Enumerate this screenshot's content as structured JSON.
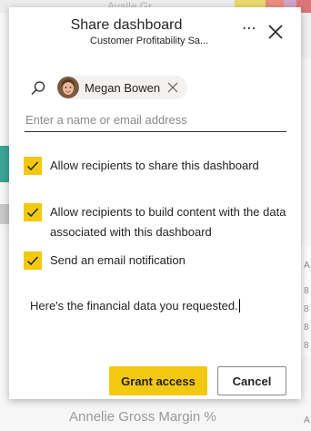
{
  "background": {
    "top_text": "Avalle Gr",
    "bottom_text": "Annelie Gross Margin %",
    "right_chars": [
      "A",
      "8",
      "8",
      "8",
      "8",
      "A"
    ],
    "bar_colors": [
      "#e8d86d",
      "#e88d80",
      "#d1a3c7",
      "#dc7575"
    ]
  },
  "dialog": {
    "title": "Share dashboard",
    "subtitle": "Customer Profitability Sa...",
    "more_label": "⋯",
    "recipient": {
      "name": "Megan Bowen"
    },
    "email_placeholder": "Enter a name or email address",
    "options": [
      {
        "label": "Allow recipients to share this dashboard",
        "checked": true
      },
      {
        "label": "Allow recipients to build content with the data associated with this dashboard",
        "checked": true
      },
      {
        "label": "Send an email notification",
        "checked": true
      }
    ],
    "message": "Here's the financial data you requested.",
    "primary_button": "Grant access",
    "secondary_button": "Cancel"
  },
  "colors": {
    "accent": "#f2c811",
    "text": "#252423",
    "placeholder": "#8a8886"
  }
}
